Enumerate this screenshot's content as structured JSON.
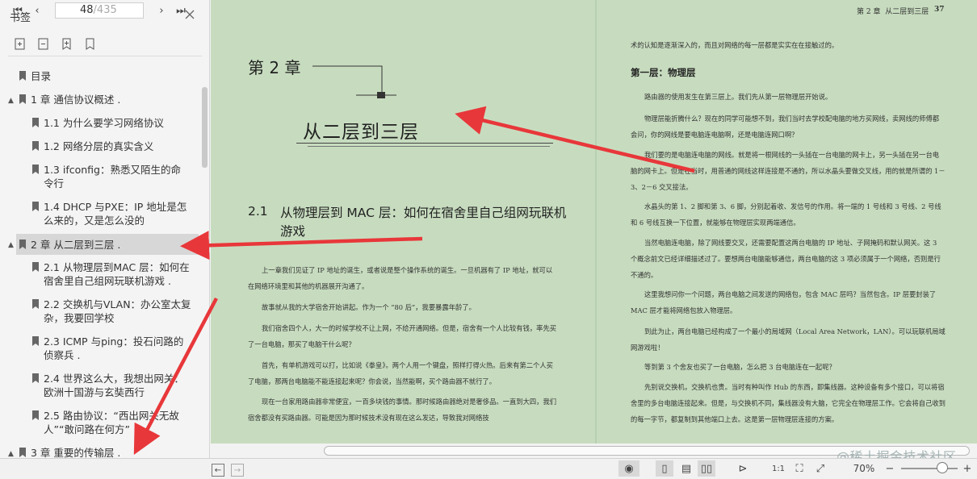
{
  "sidebar": {
    "title": "书签",
    "items": [
      {
        "label": "目录",
        "level": 0,
        "arrow": ""
      },
      {
        "label": "1 章 通信协议概述 .",
        "level": 0,
        "arrow": "▲"
      },
      {
        "label": "1.1 为什么要学习网络协议",
        "level": 1,
        "arrow": ""
      },
      {
        "label": "1.2 网络分层的真实含义",
        "level": 1,
        "arrow": ""
      },
      {
        "label": "1.3 ifconfig：熟悉又陌生的命令行",
        "level": 1,
        "arrow": ""
      },
      {
        "label": "1.4 DHCP 与PXE：IP 地址是怎么来的，又是怎么没的",
        "level": 1,
        "arrow": ""
      },
      {
        "label": "2 章 从二层到三层 .",
        "level": 0,
        "arrow": "▲"
      },
      {
        "label": "2.1 从物理层到MAC 层：如何在宿舍里自己组网玩联机游戏 .",
        "level": 1,
        "arrow": ""
      },
      {
        "label": "2.2 交换机与VLAN：办公室太复杂，我要回学校",
        "level": 1,
        "arrow": ""
      },
      {
        "label": "2.3 ICMP 与ping：投石问路的侦察兵 .",
        "level": 1,
        "arrow": ""
      },
      {
        "label": "2.4 世界这么大，我想出网关：欧洲十国游与玄奘西行",
        "level": 1,
        "arrow": ""
      },
      {
        "label": "2.5 路由协议：“西出网关无故人”“敢问路在何方”",
        "level": 1,
        "arrow": ""
      },
      {
        "label": "3 章 重要的传输层 .",
        "level": 0,
        "arrow": "▲"
      }
    ]
  },
  "page": {
    "header_chapter": "第 2 章",
    "header_title": "从二层到三层",
    "header_num": "37",
    "chapter_label": "第 2 章",
    "chapter_title": "从二层到三层",
    "section_num": "2.1",
    "section_title": "从物理层到 MAC 层：如何在宿舍里自己组网玩联机游戏",
    "left_paras": [
      "上一章我们见证了 IP 地址的诞生，或者说是整个操作系统的诞生。一旦机器有了 IP 地址，就可以在网络环境里和其他的机器展开沟通了。",
      "故事就从我的大学宿舍开始讲起。作为一个 “80 后”，我要暴露年龄了。",
      "我们宿舍四个人，大一的时候学校不让上网，不给开通网络。但是，宿舍有一个人比较有钱，率先买了一台电脑，那买了电脑干什么呢？",
      "首先，有单机游戏可以打，比如说《拳皇》。两个人用一个键盘，照样打得火热。后来有第二个人买了电脑，那两台电脑能不能连接起来呢？你会说，当然能啊，买个路由器不就行了。",
      "现在一台家用路由器非常便宜，一百多块钱的事情。那时候路由器绝对是奢侈品。一直到大四，我们宿舍都没有买路由器。可能是因为那时候技术没有现在这么发达，导致我对网络技"
    ],
    "right_intro": "术的认知是逐渐深入的，而且对网络的每一层都是实实在在接触过的。",
    "right_heading": "第一层：物理层",
    "right_paras": [
      "路由器的使用发生在第三层上。我们先从第一层物理层开始说。",
      "物理层能折腾什么？现在的同学可能想不到，我们当时去学校配电脑的地方买网线，卖网线的师傅都会问，你的网线是要电脑连电脑啊，还是电脑连网口啊？",
      "我们要的是电脑连电脑的网线。就是将一根网线的一头插在一台电脑的网卡上，另一头插在另一台电脑的网卡上。但是在当时，用普通的网线这样连接是不通的，所以水晶头要做交叉线，用的就是所谓的 1－3、2－6 交叉接法。",
      "水晶头的第 1、2 脚和第 3、6 脚，分别起着收、发信号的作用。将一端的 1 号线和 3 号线、2 号线和 6 号线互换一下位置，就能够在物理层实现两端通信。",
      "当然电脑连电脑，除了网线要交叉，还需要配置这两台电脑的 IP 地址、子网掩码和默认网关。这 3 个概念前文已经详细描述过了。要想两台电脑能够通信，两台电脑的这 3 项必须属于一个网络，否则是行不通的。",
      "这里我想问你一个问题，两台电脑之间发送的网络包，包含 MAC 层吗？当然包含。IP 层要封装了 MAC 层才能将网络包放入物理层。",
      "到此为止，两台电脑已经构成了一个最小的局域网（Local Area Network，LAN）。可以玩联机局域网游戏啦！",
      "等到第 3 个舍友也买了一台电脑，怎么把 3 台电脑连在一起呢？",
      "先别说交换机，交换机也贵。当时有种叫作 Hub 的东西，即集线器。这种设备有多个接口，可以将宿舍里的多台电脑连接起来。但是，与交换机不同，集线器没有大脑，它完全在物理层工作。它会将自己收到的每一字节，都复制到其他端口上去。这是第一层物理层连接的方案。"
    ]
  },
  "bottom": {
    "current_page": "48",
    "total_pages": "/435",
    "zoom": "70%",
    "watermark": "@稀土掘金技术社区"
  },
  "colors": {
    "page_bg": "#c7dcbf",
    "arrow": "#e8373a",
    "sidebar_bg": "#f4f4f4",
    "active_item_bg": "#d7d7d7"
  }
}
